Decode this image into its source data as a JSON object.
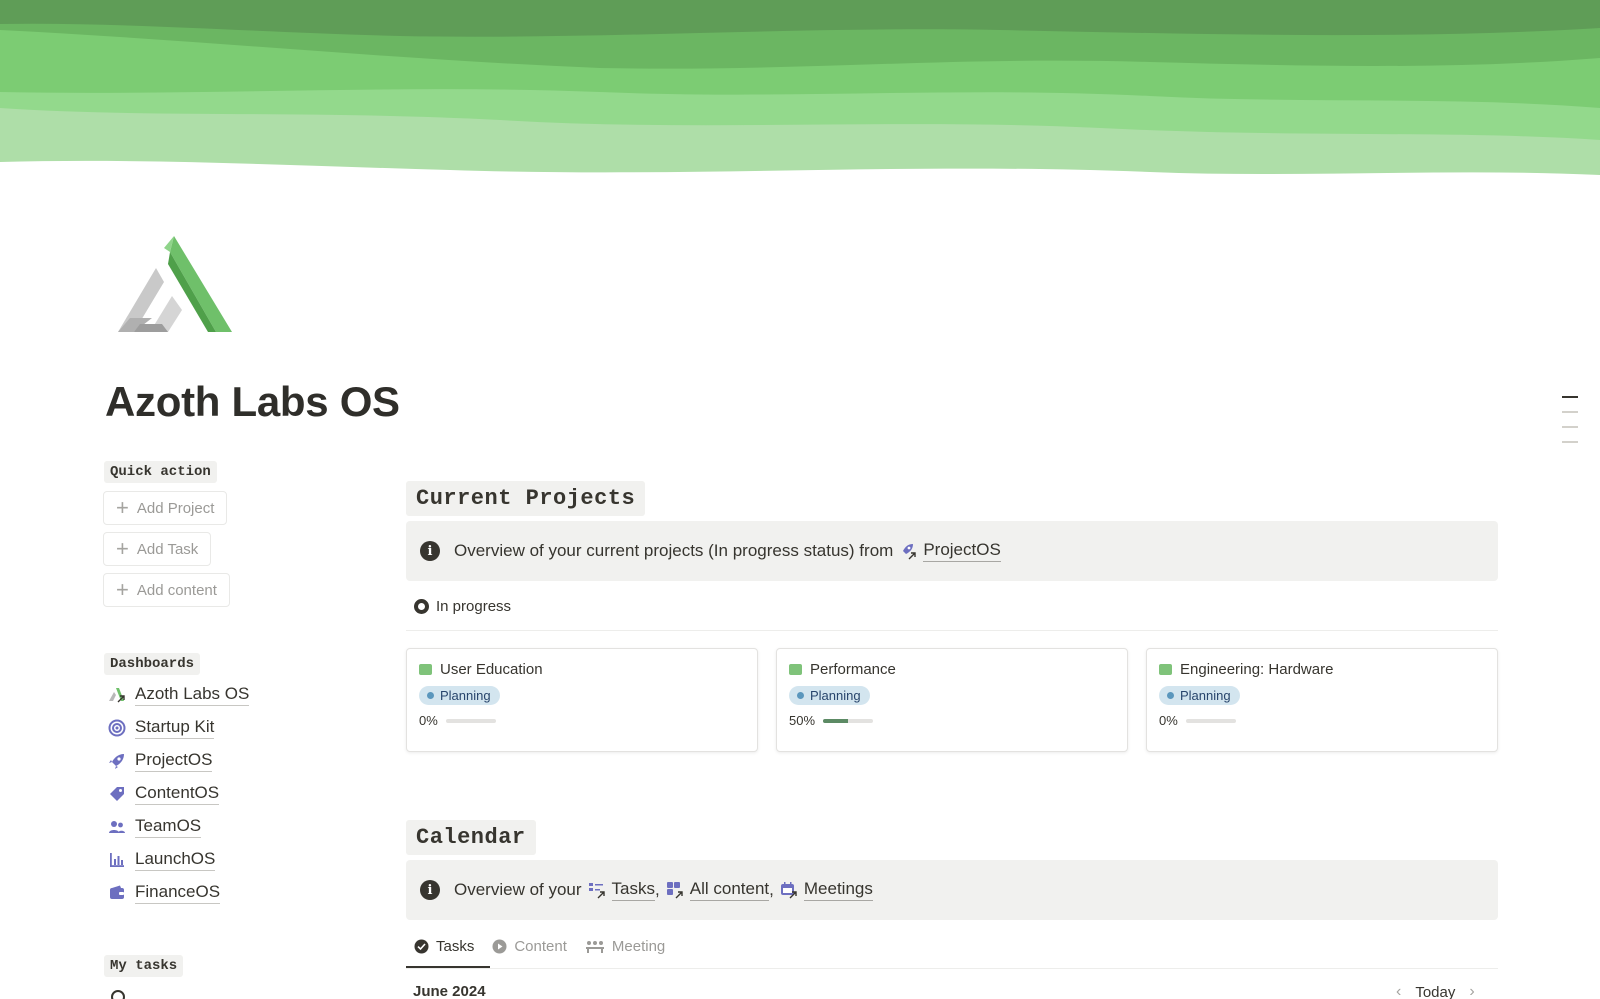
{
  "page": {
    "title": "Azoth Labs OS"
  },
  "colors": {
    "cover_dark": "#5f9d57",
    "cover_mid": "#7cd07a",
    "cover_light": "#a8dca3",
    "accent_green": "#7fc37a",
    "status_bg": "#d3e5ef",
    "icon_purple": "#6d6fc0"
  },
  "quick_action": {
    "label": "Quick action",
    "buttons": [
      {
        "label": "Add Project"
      },
      {
        "label": "Add Task"
      },
      {
        "label": "Add content"
      }
    ]
  },
  "dashboards": {
    "label": "Dashboards",
    "items": [
      {
        "label": "Azoth Labs OS",
        "icon": "azoth-logo-icon"
      },
      {
        "label": "Startup Kit",
        "icon": "target-icon"
      },
      {
        "label": "ProjectOS",
        "icon": "rocket-icon"
      },
      {
        "label": "ContentOS",
        "icon": "tag-icon"
      },
      {
        "label": "TeamOS",
        "icon": "people-icon"
      },
      {
        "label": "LaunchOS",
        "icon": "bar-chart-icon"
      },
      {
        "label": "FinanceOS",
        "icon": "wallet-icon"
      }
    ]
  },
  "my_tasks": {
    "label": "My tasks"
  },
  "current_projects": {
    "heading": "Current Projects",
    "callout": {
      "text": "Overview of your current projects (In progress status) from",
      "link": "ProjectOS"
    },
    "group": "In progress",
    "cards": [
      {
        "title": "User Education",
        "status": "Planning",
        "progress_label": "0%",
        "progress": 0
      },
      {
        "title": "Performance",
        "status": "Planning",
        "progress_label": "50%",
        "progress": 0.5
      },
      {
        "title": "Engineering: Hardware",
        "status": "Planning",
        "progress_label": "0%",
        "progress": 0
      }
    ]
  },
  "calendar": {
    "heading": "Calendar",
    "callout": {
      "text": "Overview of your",
      "links": [
        "Tasks",
        "All content",
        "Meetings"
      ],
      "separator": ","
    },
    "tabs": [
      {
        "label": "Tasks",
        "active": true
      },
      {
        "label": "Content",
        "active": false
      },
      {
        "label": "Meeting",
        "active": false
      }
    ],
    "month": "June 2024",
    "today_label": "Today"
  }
}
